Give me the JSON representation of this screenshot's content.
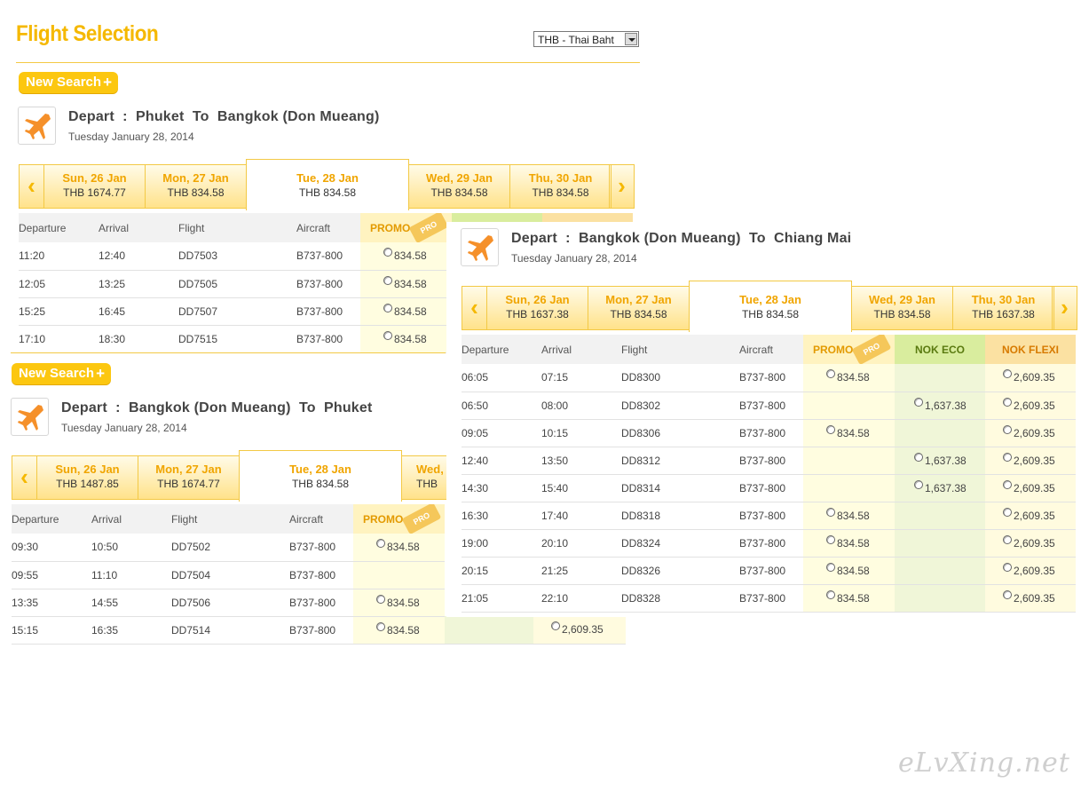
{
  "page": {
    "title": "Flight Selection",
    "currency": "THB - Thai Baht",
    "new_search_label": "New Search",
    "watermark": "eLvXing.net"
  },
  "promo_label": "PROMO",
  "tag_label": "PRO",
  "eco_label": "NOK ECO",
  "flexi_label": "NOK FLEXI",
  "columns": [
    "Departure",
    "Arrival",
    "Flight",
    "Aircraft"
  ],
  "panel1": {
    "route": "Depart  :  Phuket  To  Bangkok (Don Mueang)",
    "date": "Tuesday January 28, 2014",
    "dates": [
      {
        "day": "Sun, 26 Jan",
        "price": "THB  1674.77"
      },
      {
        "day": "Mon, 27 Jan",
        "price": "THB  834.58"
      },
      {
        "day": "Tue, 28 Jan",
        "price": "THB  834.58"
      },
      {
        "day": "Wed, 29 Jan",
        "price": "THB  834.58"
      },
      {
        "day": "Thu, 30 Jan",
        "price": "THB  834.58"
      }
    ],
    "rows": [
      {
        "dep": "11:20",
        "arr": "12:40",
        "flight": "DD7503",
        "aircraft": "B737-800",
        "promo": "834.58"
      },
      {
        "dep": "12:05",
        "arr": "13:25",
        "flight": "DD7505",
        "aircraft": "B737-800",
        "promo": "834.58"
      },
      {
        "dep": "15:25",
        "arr": "16:45",
        "flight": "DD7507",
        "aircraft": "B737-800",
        "promo": "834.58"
      },
      {
        "dep": "17:10",
        "arr": "18:30",
        "flight": "DD7515",
        "aircraft": "B737-800",
        "promo": "834.58"
      }
    ]
  },
  "panel2": {
    "route": "Depart  :  Bangkok (Don Mueang)  To  Phuket",
    "date": "Tuesday January 28, 2014",
    "dates": [
      {
        "day": "Sun, 26 Jan",
        "price": "THB  1487.85"
      },
      {
        "day": "Mon, 27 Jan",
        "price": "THB  1674.77"
      },
      {
        "day": "Tue, 28 Jan",
        "price": "THB  834.58"
      },
      {
        "day": "Wed,",
        "price": "THB"
      }
    ],
    "rows": [
      {
        "dep": "09:30",
        "arr": "10:50",
        "flight": "DD7502",
        "aircraft": "B737-800",
        "promo": "834.58",
        "flexi": ""
      },
      {
        "dep": "09:55",
        "arr": "11:10",
        "flight": "DD7504",
        "aircraft": "B737-800",
        "promo": "",
        "flexi": ""
      },
      {
        "dep": "13:35",
        "arr": "14:55",
        "flight": "DD7506",
        "aircraft": "B737-800",
        "promo": "834.58",
        "flexi": ""
      },
      {
        "dep": "15:15",
        "arr": "16:35",
        "flight": "DD7514",
        "aircraft": "B737-800",
        "promo": "834.58",
        "flexi": "2,609.35"
      }
    ]
  },
  "panel3": {
    "route": "Depart  :  Bangkok (Don Mueang)  To  Chiang Mai",
    "date": "Tuesday January 28, 2014",
    "dates": [
      {
        "day": "Sun, 26 Jan",
        "price": "THB  1637.38"
      },
      {
        "day": "Mon, 27 Jan",
        "price": "THB  834.58"
      },
      {
        "day": "Tue, 28 Jan",
        "price": "THB  834.58"
      },
      {
        "day": "Wed, 29 Jan",
        "price": "THB  834.58"
      },
      {
        "day": "Thu, 30 Jan",
        "price": "THB  1637.38"
      }
    ],
    "rows": [
      {
        "dep": "06:05",
        "arr": "07:15",
        "flight": "DD8300",
        "aircraft": "B737-800",
        "promo": "834.58",
        "eco": "",
        "flexi": "2,609.35"
      },
      {
        "dep": "06:50",
        "arr": "08:00",
        "flight": "DD8302",
        "aircraft": "B737-800",
        "promo": "",
        "eco": "1,637.38",
        "flexi": "2,609.35"
      },
      {
        "dep": "09:05",
        "arr": "10:15",
        "flight": "DD8306",
        "aircraft": "B737-800",
        "promo": "834.58",
        "eco": "",
        "flexi": "2,609.35"
      },
      {
        "dep": "12:40",
        "arr": "13:50",
        "flight": "DD8312",
        "aircraft": "B737-800",
        "promo": "",
        "eco": "1,637.38",
        "flexi": "2,609.35"
      },
      {
        "dep": "14:30",
        "arr": "15:40",
        "flight": "DD8314",
        "aircraft": "B737-800",
        "promo": "",
        "eco": "1,637.38",
        "flexi": "2,609.35"
      },
      {
        "dep": "16:30",
        "arr": "17:40",
        "flight": "DD8318",
        "aircraft": "B737-800",
        "promo": "834.58",
        "eco": "",
        "flexi": "2,609.35"
      },
      {
        "dep": "19:00",
        "arr": "20:10",
        "flight": "DD8324",
        "aircraft": "B737-800",
        "promo": "834.58",
        "eco": "",
        "flexi": "2,609.35"
      },
      {
        "dep": "20:15",
        "arr": "21:25",
        "flight": "DD8326",
        "aircraft": "B737-800",
        "promo": "834.58",
        "eco": "",
        "flexi": "2,609.35"
      },
      {
        "dep": "21:05",
        "arr": "22:10",
        "flight": "DD8328",
        "aircraft": "B737-800",
        "promo": "834.58",
        "eco": "",
        "flexi": "2,609.35"
      }
    ]
  }
}
